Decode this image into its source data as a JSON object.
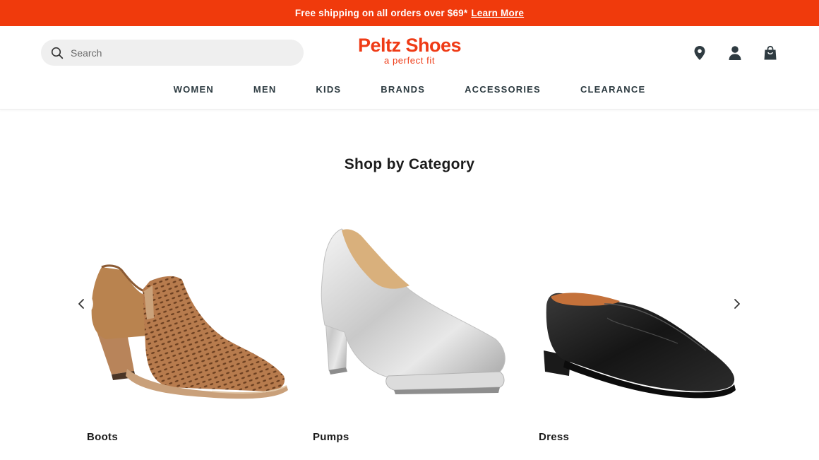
{
  "promo": {
    "text": "Free shipping on all orders over $69*",
    "link": "Learn More"
  },
  "search": {
    "placeholder": "Search"
  },
  "brand": {
    "name": "Peltz Shoes",
    "tagline": "a perfect fit",
    "accent_color": "#ef3b16"
  },
  "header_icons": [
    "location-pin-icon",
    "account-icon",
    "shopping-bag-icon"
  ],
  "nav": [
    "WOMEN",
    "MEN",
    "KIDS",
    "BRANDS",
    "ACCESSORIES",
    "CLEARANCE"
  ],
  "section": {
    "title": "Shop by Category"
  },
  "categories": [
    {
      "label": "Boots",
      "image": "tan-perforated-bootie"
    },
    {
      "label": "Pumps",
      "image": "silver-platform-pump"
    },
    {
      "label": "Dress",
      "image": "black-leather-loafer"
    }
  ],
  "carousel": {
    "prev_icon": "chevron-left-icon",
    "next_icon": "chevron-right-icon"
  }
}
